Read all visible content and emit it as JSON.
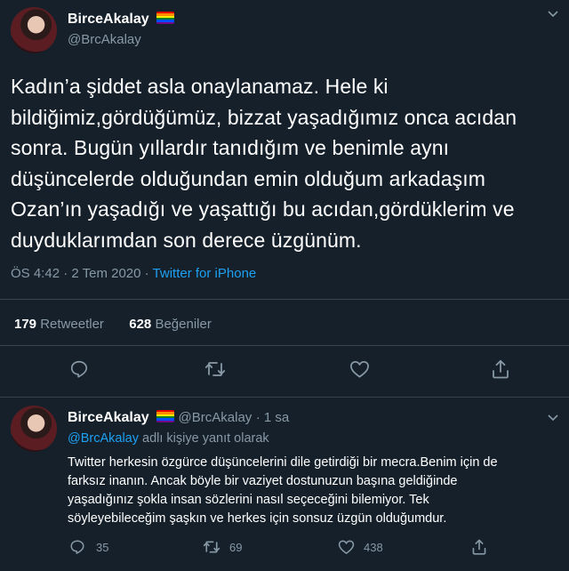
{
  "main_tweet": {
    "display_name": "BirceAkalay",
    "handle": "@BrcAkalay",
    "text_lines": [
      "Kadın’a şiddet asla onaylanamaz. Hele ki",
      "bildiğimiz,gördüğümüz, bizzat yaşadığımız onca acıdan",
      "sonra. Bugün yıllardır tanıdığım ve benimle aynı",
      "düşüncelerde olduğundan emin olduğum arkadaşım",
      "Ozan’ın yaşadığı ve yaşattığı bu acıdan,gördüklerim ve",
      "duyduklarımdan son derece üzgünüm."
    ],
    "time": "ÖS 4:42 · 2 Tem 2020 · ",
    "source": "Twitter for iPhone",
    "retweets_count": "179",
    "retweets_label": "Retweetler",
    "likes_count": "628",
    "likes_label": "Beğeniler",
    "actions": [
      "reply-icon",
      "retweet-icon",
      "like-icon",
      "share-icon"
    ]
  },
  "reply_tweet": {
    "display_name": "BirceAkalay",
    "handle": "@BrcAkalay",
    "time": "· 1 sa",
    "replying_to_handle": "@BrcAkalay",
    "replying_to_suffix": " adlı kişiye yanıt olarak",
    "text_lines": [
      "Twitter herkesin özgürce düşüncelerini dile getirdiği bir mecra.Benim için de",
      "farksız inanın. Ancak böyle bir vaziyet dostunuzun başına geldiğinde",
      "yaşadığınız şokla insan sözlerini nasıl seçeceğini bilemiyor. Tek",
      "söyleyebileceğim şaşkın ve herkes için sonsuz üzgün olduğumdur."
    ],
    "reply_count": "35",
    "retweet_count": "69",
    "like_count": "438"
  },
  "colors": {
    "background": "#15202b",
    "secondary_text": "#8899a6",
    "link": "#1da1f2",
    "divider": "#38444d"
  }
}
